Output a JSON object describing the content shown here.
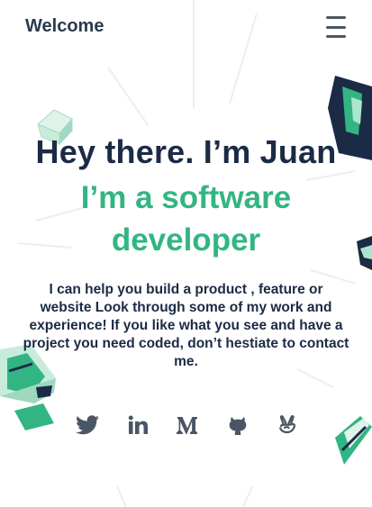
{
  "header": {
    "brand": "Welcome",
    "menu_icon": "hamburger-menu-icon"
  },
  "hero": {
    "title": "Hey there. I’m Juan",
    "subtitle": "I’m a software developer",
    "intro": "I can help you build a product , feature or website Look through some of my work and experience! If you like what you see and have a project you need coded, don’t hestiate to contact me."
  },
  "social": [
    {
      "icon": "twitter-icon"
    },
    {
      "icon": "linkedin-icon"
    },
    {
      "icon": "medium-icon"
    },
    {
      "icon": "github-icon"
    },
    {
      "icon": "angellist-icon"
    }
  ],
  "colors": {
    "navy": "#1b2b45",
    "green": "#33b583",
    "icon_gray": "#4a5566"
  }
}
